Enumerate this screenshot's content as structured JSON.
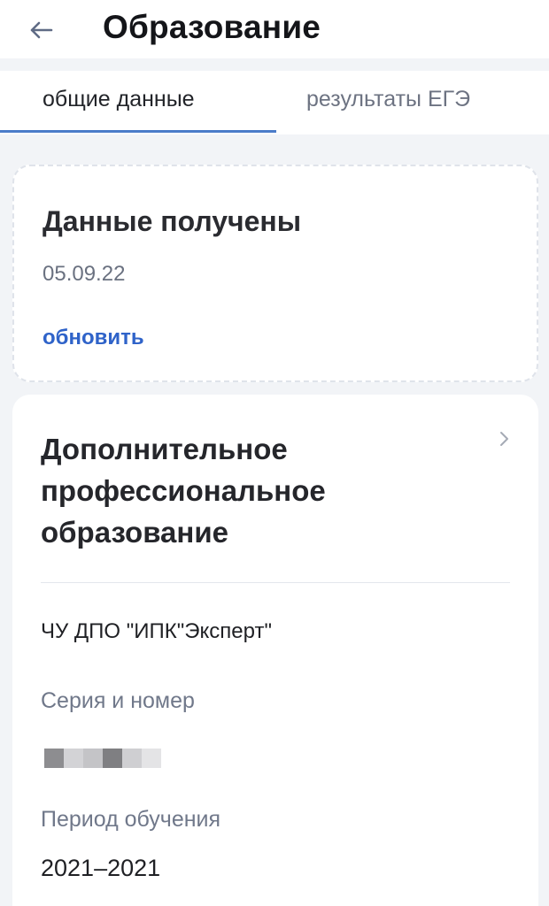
{
  "header": {
    "title": "Образование",
    "back_icon": "arrow-left-icon"
  },
  "tabs": [
    {
      "label": "общие данные",
      "active": true
    },
    {
      "label": "результаты ЕГЭ",
      "active": false
    }
  ],
  "status_card": {
    "title": "Данные получены",
    "date": "05.09.22",
    "refresh_label": "обновить"
  },
  "education_card": {
    "title": "Дополнительное профессиональное образование",
    "chevron_icon": "chevron-right-icon",
    "organization": "ЧУ ДПО \"ИПК\"Эксперт\"",
    "series_label": "Серия и номер",
    "period_label": "Период обучения",
    "period_value": "2021–2021"
  },
  "colors": {
    "accent": "#2f63c9",
    "tab_indicator": "#4b7cc9",
    "background": "#f2f4f7",
    "card": "#ffffff"
  }
}
